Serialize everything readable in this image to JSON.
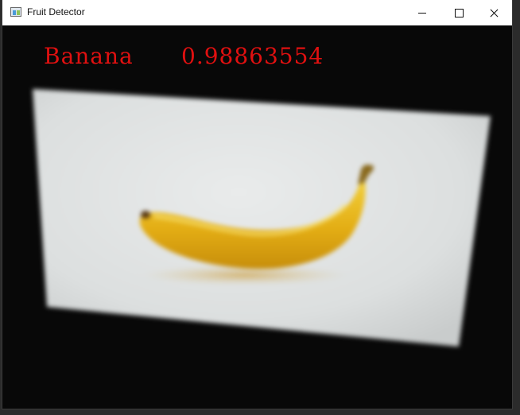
{
  "window": {
    "title": "Fruit Detector",
    "controls": [
      "minimize",
      "maximize",
      "close"
    ]
  },
  "detection": {
    "class_label": "Banana",
    "confidence": "0.98863554",
    "text_color": "#e01010"
  },
  "scene": {
    "subject": "banana",
    "card_color": "#dfe2e2",
    "banana_color": "#e6b51c",
    "background_color": "#080808"
  }
}
